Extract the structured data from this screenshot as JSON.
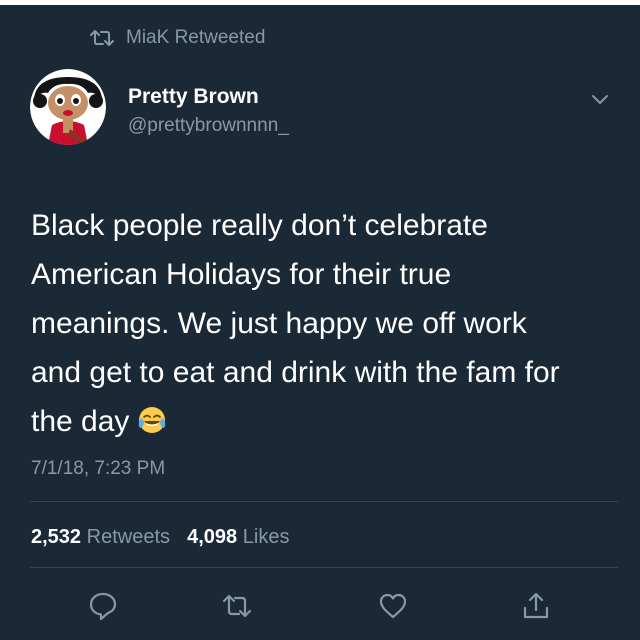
{
  "retweet_banner": {
    "icon": "retweet-icon",
    "text": "MiaK Retweeted"
  },
  "author": {
    "name": "Pretty Brown",
    "handle": "@prettybrownnnn_",
    "avatar": "cartoon-avatar"
  },
  "menu": {
    "icon": "chevron-down-icon"
  },
  "tweet": {
    "lines": [
      "Black people really don’t celebrate",
      "American Holidays for their true",
      "meanings. We just happy we off work",
      "and get to eat and drink with the fam for",
      "the day"
    ],
    "emoji": "face-with-tears-of-joy-emoji",
    "timestamp": "7/1/18, 7:23 PM"
  },
  "stats": {
    "retweets_count": "2,532",
    "retweets_label": "Retweets",
    "likes_count": "4,098",
    "likes_label": "Likes"
  },
  "actions": [
    {
      "icon": "reply-icon"
    },
    {
      "icon": "retweet-icon"
    },
    {
      "icon": "heart-icon"
    },
    {
      "icon": "share-icon"
    }
  ],
  "colors": {
    "background": "#1b2836",
    "primary_text": "#ffffff",
    "secondary_text": "#8899a6",
    "divider": "#38444d"
  }
}
